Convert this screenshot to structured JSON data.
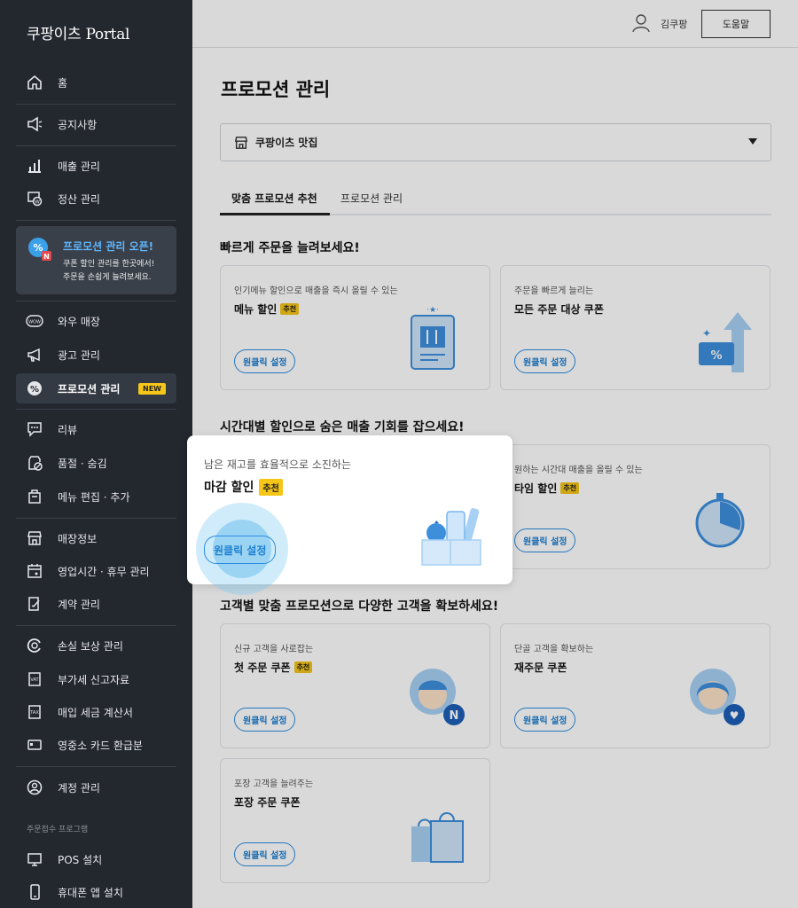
{
  "brand": "쿠팡이츠 Portal",
  "sidebar": {
    "items": [
      {
        "label": "홈",
        "icon": "home-icon"
      },
      {
        "label": "공지사항",
        "icon": "megaphone-icon"
      },
      {
        "label": "매출 관리",
        "icon": "bar-chart-icon"
      },
      {
        "label": "정산 관리",
        "icon": "settlement-icon"
      },
      {
        "label": "와우 매장",
        "icon": "wow-icon"
      },
      {
        "label": "광고 관리",
        "icon": "ad-icon"
      },
      {
        "label": "프로모션 관리",
        "icon": "promotion-icon",
        "badge": "NEW"
      },
      {
        "label": "리뷰",
        "icon": "review-icon"
      },
      {
        "label": "품절 · 숨김",
        "icon": "soldout-icon"
      },
      {
        "label": "메뉴 편집 · 추가",
        "icon": "menu-edit-icon"
      },
      {
        "label": "매장정보",
        "icon": "store-icon"
      },
      {
        "label": "영업시간 · 휴무 관리",
        "icon": "calendar-icon"
      },
      {
        "label": "계약 관리",
        "icon": "contract-icon"
      },
      {
        "label": "손실 보상 관리",
        "icon": "compensation-icon"
      },
      {
        "label": "부가세 신고자료",
        "icon": "vat-icon"
      },
      {
        "label": "매입 세금 계산서",
        "icon": "tax-invoice-icon"
      },
      {
        "label": "영중소 카드 환급분",
        "icon": "card-icon"
      },
      {
        "label": "계정 관리",
        "icon": "account-icon"
      },
      {
        "label": "POS 설치",
        "icon": "monitor-icon"
      },
      {
        "label": "휴대폰 앱 설치",
        "icon": "phone-icon"
      }
    ],
    "promo_banner": {
      "title": "프로모션 관리 오픈!",
      "desc1": "쿠폰 할인 관리를 한곳에서!",
      "desc2": "주문을 손쉽게 늘려보세요."
    },
    "section_label": "주문접수 프로그램"
  },
  "header": {
    "user_name": "김쿠팡",
    "help_label": "도움말"
  },
  "main": {
    "title": "프로모션 관리",
    "store_name": "쿠팡이츠 맛집",
    "tabs": [
      "맞춤 프로모션 추천",
      "프로모션 관리"
    ],
    "sections": [
      "빠르게 주문을 늘려보세요!",
      "시간대별 할인으로 숨은 매출 기회를 잡으세요!",
      "고객별 맞춤 프로모션으로 다양한 고객을 확보하세요!"
    ],
    "one_click_label": "원클릭 설정",
    "recommend_badge": "추천",
    "cards": [
      {
        "desc": "인기메뉴 할인으로 매출을 즉시 올릴 수 있는",
        "title": "메뉴 할인",
        "recommended": true
      },
      {
        "desc": "주문을 빠르게 늘리는",
        "title": "모든 주문 대상 쿠폰",
        "recommended": false
      },
      {
        "desc": "원하는 시간대 매출을 올릴 수 있는",
        "title": "타임 할인",
        "recommended": true
      },
      {
        "desc": "신규 고객을 사로잡는",
        "title": "첫 주문 쿠폰",
        "recommended": true
      },
      {
        "desc": "단골 고객을 확보하는",
        "title": "재주문 쿠폰",
        "recommended": false
      },
      {
        "desc": "포장 고객을 늘려주는",
        "title": "포장 주문 쿠폰",
        "recommended": false
      }
    ],
    "popup": {
      "desc": "남은 재고를 효율적으로 소진하는",
      "title": "마감 할인",
      "recommended": true
    }
  },
  "colors": {
    "sidebar_bg": "#23272e",
    "accent_blue": "#1d7fd1",
    "badge_yellow": "#f5c518"
  }
}
